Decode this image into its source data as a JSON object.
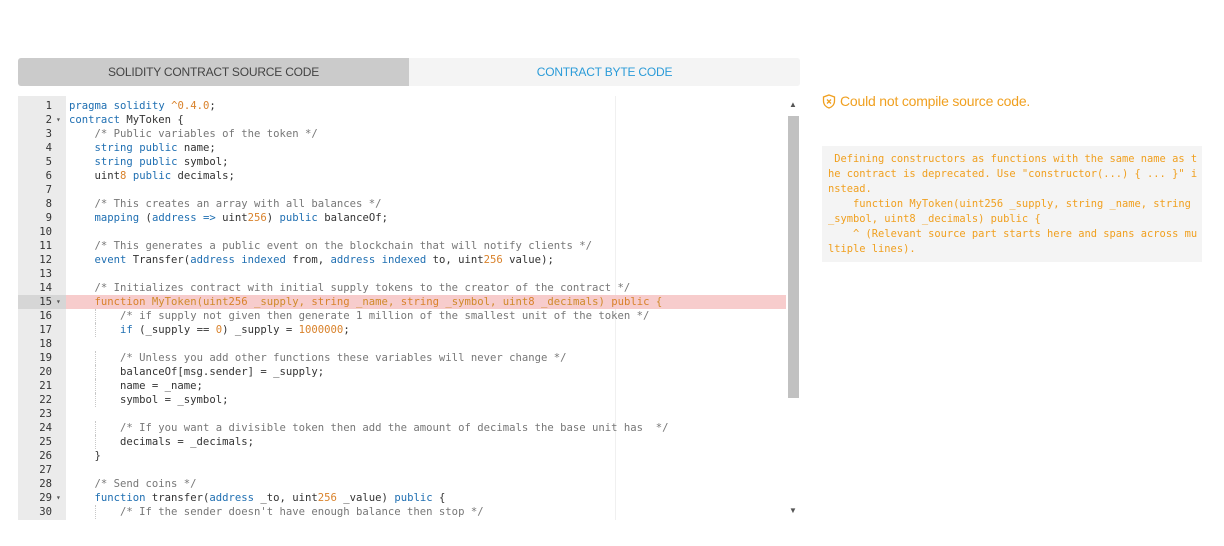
{
  "tabs": [
    {
      "label": "SOLIDITY CONTRACT SOURCE CODE",
      "active": false
    },
    {
      "label": "CONTRACT BYTE CODE",
      "active": true
    }
  ],
  "editor": {
    "highlighted_line": 15,
    "lines": [
      {
        "n": "1",
        "fold": false,
        "text": "pragma solidity ^0.4.0;"
      },
      {
        "n": "2",
        "fold": true,
        "text": "contract MyToken {"
      },
      {
        "n": "3",
        "fold": false,
        "text": "    /* Public variables of the token */"
      },
      {
        "n": "4",
        "fold": false,
        "text": "    string public name;"
      },
      {
        "n": "5",
        "fold": false,
        "text": "    string public symbol;"
      },
      {
        "n": "6",
        "fold": false,
        "text": "    uint8 public decimals;"
      },
      {
        "n": "7",
        "fold": false,
        "text": ""
      },
      {
        "n": "8",
        "fold": false,
        "text": "    /* This creates an array with all balances */"
      },
      {
        "n": "9",
        "fold": false,
        "text": "    mapping (address => uint256) public balanceOf;"
      },
      {
        "n": "10",
        "fold": false,
        "text": ""
      },
      {
        "n": "11",
        "fold": false,
        "text": "    /* This generates a public event on the blockchain that will notify clients */"
      },
      {
        "n": "12",
        "fold": false,
        "text": "    event Transfer(address indexed from, address indexed to, uint256 value);"
      },
      {
        "n": "13",
        "fold": false,
        "text": ""
      },
      {
        "n": "14",
        "fold": false,
        "text": "    /* Initializes contract with initial supply tokens to the creator of the contract */"
      },
      {
        "n": "15",
        "fold": true,
        "text": "    function MyToken(uint256 _supply, string _name, string _symbol, uint8 _decimals) public {"
      },
      {
        "n": "16",
        "fold": false,
        "text": "        /* if supply not given then generate 1 million of the smallest unit of the token */"
      },
      {
        "n": "17",
        "fold": false,
        "text": "        if (_supply == 0) _supply = 1000000;"
      },
      {
        "n": "18",
        "fold": false,
        "text": ""
      },
      {
        "n": "19",
        "fold": false,
        "text": "        /* Unless you add other functions these variables will never change */"
      },
      {
        "n": "20",
        "fold": false,
        "text": "        balanceOf[msg.sender] = _supply;"
      },
      {
        "n": "21",
        "fold": false,
        "text": "        name = _name;"
      },
      {
        "n": "22",
        "fold": false,
        "text": "        symbol = _symbol;"
      },
      {
        "n": "23",
        "fold": false,
        "text": ""
      },
      {
        "n": "24",
        "fold": false,
        "text": "        /* If you want a divisible token then add the amount of decimals the base unit has  */"
      },
      {
        "n": "25",
        "fold": false,
        "text": "        decimals = _decimals;"
      },
      {
        "n": "26",
        "fold": false,
        "text": "    }"
      },
      {
        "n": "27",
        "fold": false,
        "text": ""
      },
      {
        "n": "28",
        "fold": false,
        "text": "    /* Send coins */"
      },
      {
        "n": "29",
        "fold": true,
        "text": "    function transfer(address _to, uint256 _value) public {"
      },
      {
        "n": "30",
        "fold": false,
        "text": "        /* If the sender doesn't have enough balance then stop */"
      }
    ]
  },
  "error": {
    "icon": "error-shield-icon",
    "title": "Could not compile source code.",
    "message": " Defining constructors as functions with the same name as the contract is deprecated. Use \"constructor(...) { ... }\" instead.\n    function MyToken(uint256 _supply, string _name, string _symbol, uint8 _decimals) public {\n    ^ (Relevant source part starts here and spans across multiple lines)."
  },
  "colors": {
    "tab_active_text": "#2b9bd8",
    "tab_inactive_bg": "#cbcbcb",
    "warning": "#f0a020",
    "highlight_line": "#f7cccc",
    "keyword": "#1f6fb2",
    "number": "#d9822b",
    "comment": "#777777"
  }
}
